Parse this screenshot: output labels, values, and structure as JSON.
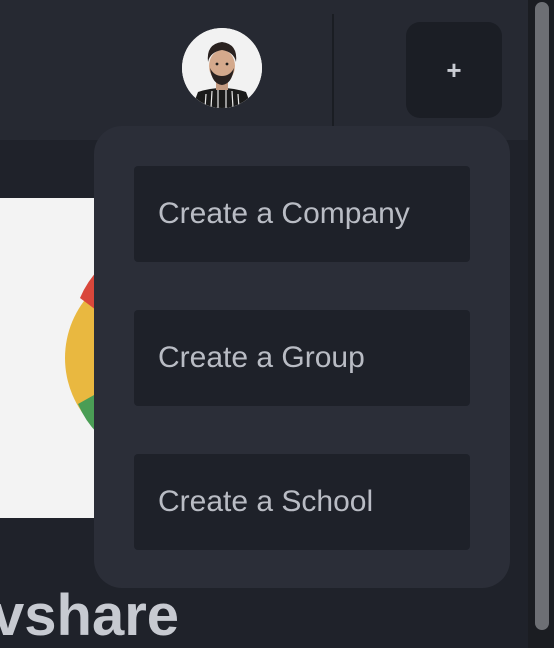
{
  "header": {
    "add_button_label": "+",
    "avatar_icon": "user-avatar"
  },
  "dropdown": {
    "items": [
      {
        "label": "Create a Company"
      },
      {
        "label": "Create a Group"
      },
      {
        "label": "Create a School"
      }
    ]
  },
  "card": {
    "title_fragment": "vshare",
    "image_icon": "chrome-logo"
  },
  "colors": {
    "background": "#1f222a",
    "topbar": "#262932",
    "dropdown_bg": "#2b2e38",
    "menu_item_bg": "#1e2129",
    "menu_text": "#b9bcc4"
  }
}
